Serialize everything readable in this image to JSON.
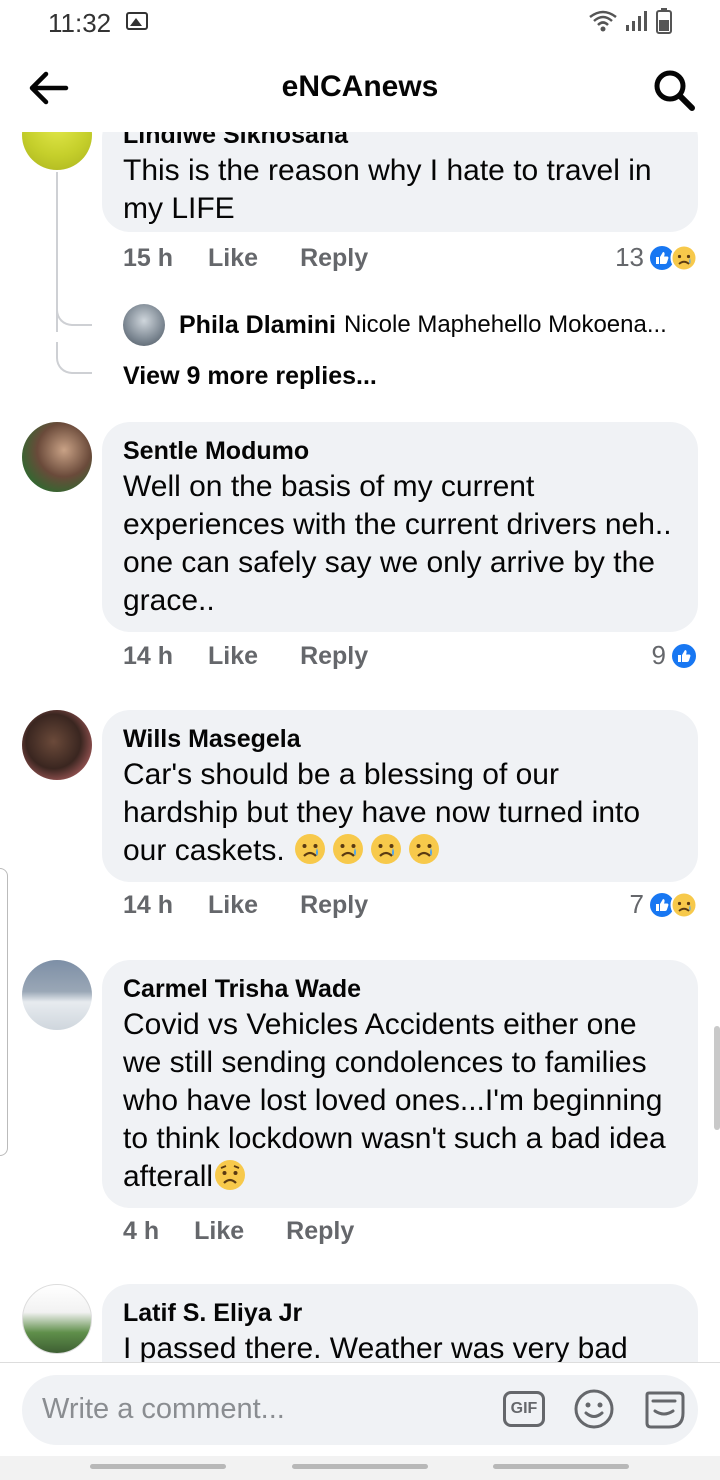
{
  "status": {
    "time": "11:32"
  },
  "header": {
    "title": "eNCAnews"
  },
  "comments": [
    {
      "author": "Lindiwe Sikhosana",
      "text": [
        "This is the reason why I hate to travel in",
        "my LIFE"
      ],
      "time": "15 h",
      "like_label": "Like",
      "reply_label": "Reply",
      "reaction_count": "13",
      "reactions": [
        "like-icon",
        "sad-icon"
      ]
    },
    {
      "author": "Sentle Modumo",
      "text": [
        "Well on the basis of my current",
        "experiences with the current drivers neh..",
        "one can safely say we only arrive by the",
        "grace.."
      ],
      "time": "14 h",
      "like_label": "Like",
      "reply_label": "Reply",
      "reaction_count": "9",
      "reactions": [
        "like-icon"
      ]
    },
    {
      "author": "Wills Masegela",
      "text": [
        "Car's should be a blessing of our",
        "hardship but they have now turned into",
        "our caskets."
      ],
      "time": "14 h",
      "like_label": "Like",
      "reply_label": "Reply",
      "reaction_count": "7",
      "reactions": [
        "like-icon",
        "sad-icon"
      ]
    },
    {
      "author": "Carmel Trisha Wade",
      "text": [
        "Covid vs Vehicles Accidents either one",
        "we still sending condolences to families",
        "who have lost loved ones...I'm beginning",
        "to think lockdown wasn't such a bad idea",
        "afterall"
      ],
      "time": "4 h",
      "like_label": "Like",
      "reply_label": "Reply"
    },
    {
      "author": "Latif S. Eliya Jr",
      "text": [
        "I passed there. Weather was very bad"
      ]
    }
  ],
  "reply_preview": {
    "name": "Phila Dlamini",
    "text": "Nicole Maphehello Mokoena..."
  },
  "more_replies": "View 9 more replies...",
  "composer": {
    "placeholder": "Write a comment...",
    "gif_label": "GIF"
  },
  "colors": {
    "accent": "#1877f2",
    "bubble": "#f0f2f5",
    "muted": "#65676b"
  }
}
